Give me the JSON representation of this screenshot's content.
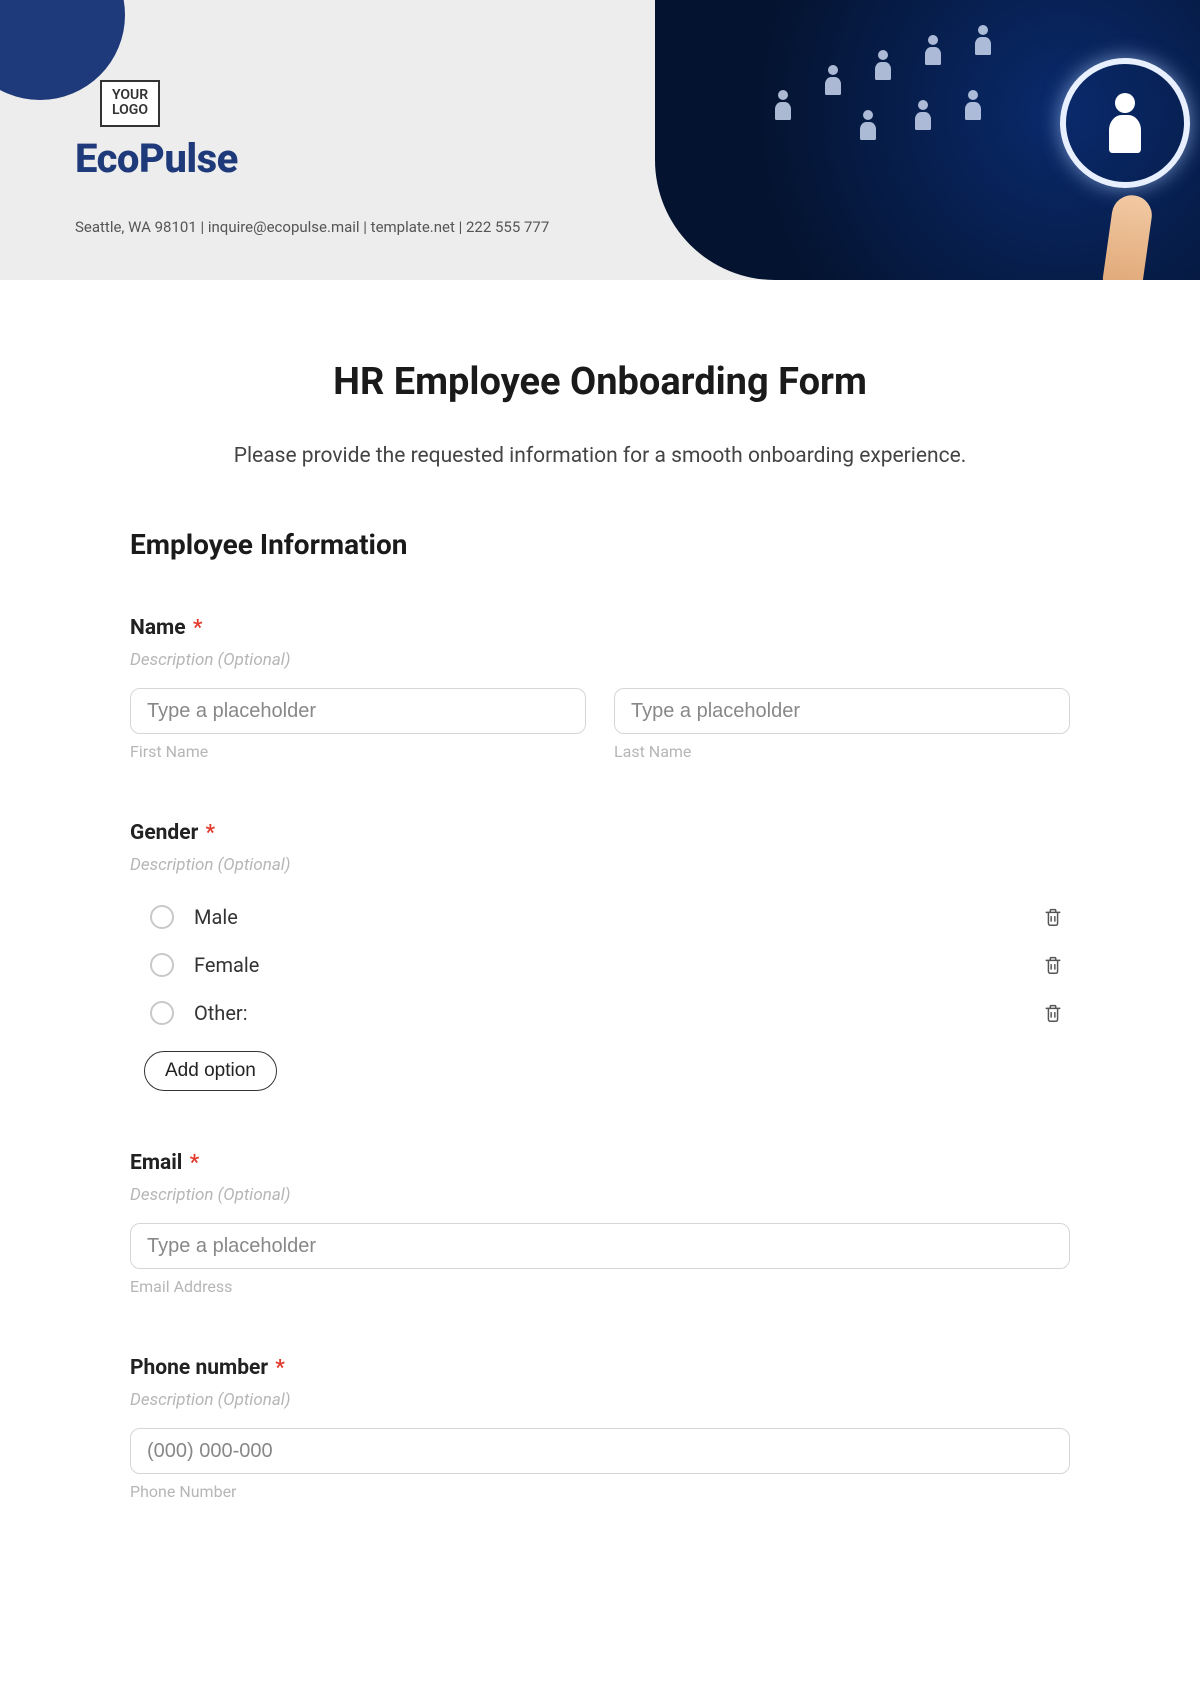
{
  "header": {
    "logo_text_l1": "YOUR",
    "logo_text_l2": "LOGO",
    "brand": "EcoPulse",
    "contact": "Seattle, WA 98101 | inquire@ecopulse.mail | template.net | 222 555 777"
  },
  "form": {
    "title": "HR Employee Onboarding Form",
    "intro": "Please provide the requested information for a smooth onboarding experience.",
    "section_title": "Employee Information",
    "desc_placeholder": "Description (Optional)",
    "generic_placeholder": "Type a placeholder",
    "required_mark": "*",
    "add_option_label": "Add option",
    "fields": {
      "name": {
        "label": "Name",
        "first_sub": "First Name",
        "last_sub": "Last Name"
      },
      "gender": {
        "label": "Gender",
        "options": [
          "Male",
          "Female",
          "Other:"
        ]
      },
      "email": {
        "label": "Email",
        "sub": "Email Address"
      },
      "phone": {
        "label": "Phone number",
        "placeholder": "(000) 000-000",
        "sub": "Phone Number"
      }
    }
  }
}
